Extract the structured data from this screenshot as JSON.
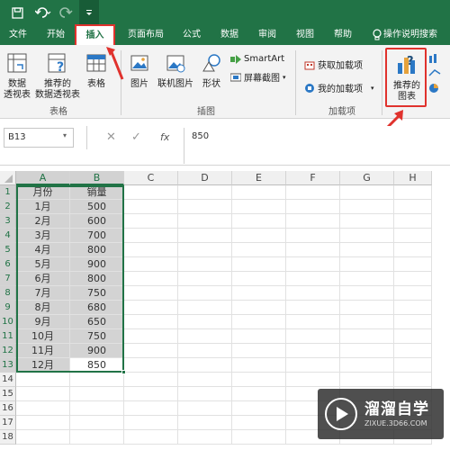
{
  "colors": {
    "excel_green": "#217346",
    "highlight_red": "#e0322d",
    "selection": "#d3d3d3"
  },
  "quick_access": {
    "icons": [
      "save-icon",
      "undo-icon",
      "redo-icon",
      "customize-icon"
    ]
  },
  "tabs": [
    "文件",
    "开始",
    "插入",
    "页面布局",
    "公式",
    "数据",
    "审阅",
    "视图",
    "帮助"
  ],
  "tell_me": "操作说明搜索",
  "ribbon": {
    "pivot_table": "数据\n透视表",
    "recommended_pivot": "推荐的\n数据透视表",
    "table": "表格",
    "group_tables": "表格",
    "pictures": "图片",
    "online_pictures": "联机图片",
    "shapes": "形状",
    "smartart": "SmartArt",
    "screenshot": "屏幕截图",
    "group_illustrations": "插图",
    "get_addins": "获取加载项",
    "my_addins": "我的加载项",
    "group_addins": "加载项",
    "recommended_charts": "推荐的\n图表"
  },
  "formula_bar": {
    "name_box": "B13",
    "fx": "fx",
    "value": "850"
  },
  "columns": [
    "A",
    "B",
    "C",
    "D",
    "E",
    "F",
    "G",
    "H"
  ],
  "rows": [
    "1",
    "2",
    "3",
    "4",
    "5",
    "6",
    "7",
    "8",
    "9",
    "10",
    "11",
    "12",
    "13",
    "14",
    "15",
    "16",
    "17",
    "18"
  ],
  "sheet": {
    "header": [
      "月份",
      "销量"
    ],
    "data": [
      [
        "1月",
        "500"
      ],
      [
        "2月",
        "600"
      ],
      [
        "3月",
        "700"
      ],
      [
        "4月",
        "800"
      ],
      [
        "5月",
        "900"
      ],
      [
        "6月",
        "800"
      ],
      [
        "7月",
        "750"
      ],
      [
        "8月",
        "680"
      ],
      [
        "9月",
        "650"
      ],
      [
        "10月",
        "750"
      ],
      [
        "11月",
        "900"
      ],
      [
        "12月",
        "850"
      ]
    ]
  },
  "watermark": {
    "title": "溜溜自学",
    "url": "ZIXUE.3D66.COM"
  }
}
